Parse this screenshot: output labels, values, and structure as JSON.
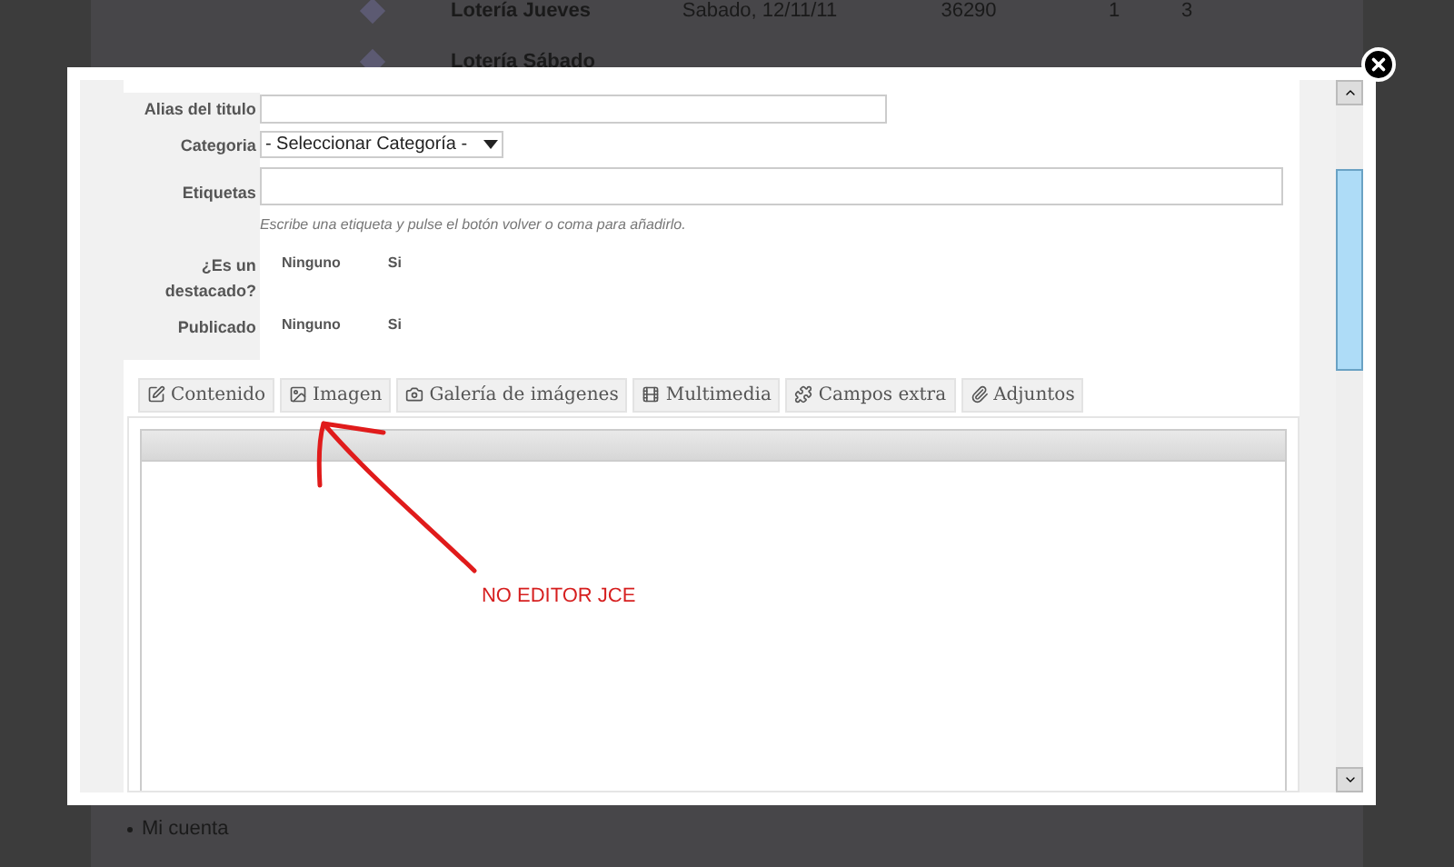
{
  "background": {
    "table_rows": [
      {
        "name": "Lotería Jueves",
        "date": "Sabado, 12/11/11",
        "number": "36290",
        "fraction": "1",
        "series": "3"
      },
      {
        "name": "Lotería Sábado"
      }
    ],
    "menu_items": [
      "Mi cuenta"
    ]
  },
  "form": {
    "fields": [
      {
        "kind": "text",
        "label": "Alias del titulo"
      },
      {
        "kind": "select",
        "label": "Categoria",
        "value": "- Seleccionar Categoría -"
      },
      {
        "kind": "tags",
        "label": "Etiquetas",
        "hint": "Escribe una etiqueta y pulse el botón volver o coma para añadirlo."
      },
      {
        "kind": "choice",
        "label": "¿Es un destacado?",
        "options": [
          "Ninguno",
          "Si"
        ]
      },
      {
        "kind": "choice",
        "label": "Publicado",
        "options": [
          "Ninguno",
          "Si"
        ]
      }
    ]
  },
  "tabs": [
    {
      "label": "Contenido",
      "selected": false
    },
    {
      "label": "Imagen",
      "selected": false
    },
    {
      "label": "Galería de imágenes",
      "selected": false
    },
    {
      "label": "Multimedia",
      "selected": false
    },
    {
      "label": "Campos extra",
      "selected": false
    },
    {
      "label": "Adjuntos",
      "selected": false
    }
  ],
  "annotation": {
    "text": "NO EDITOR JCE"
  }
}
